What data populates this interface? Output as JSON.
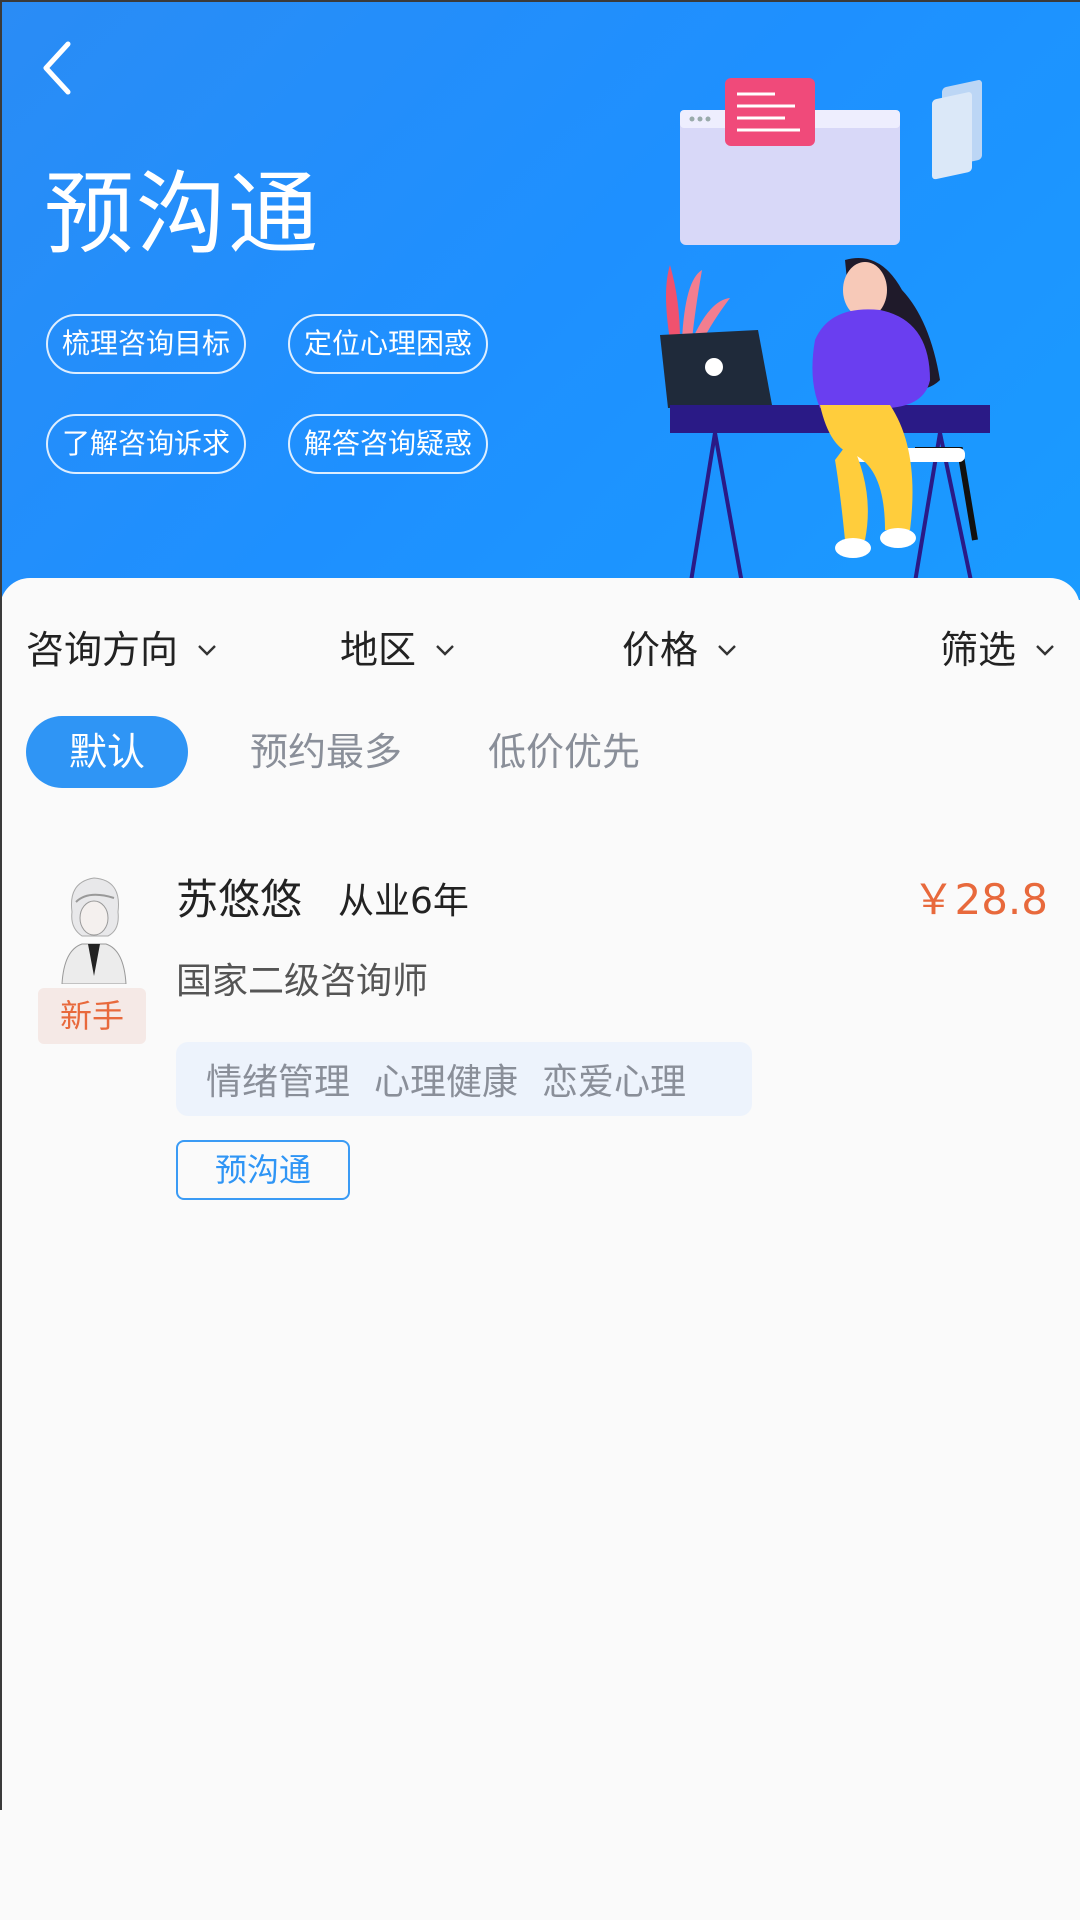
{
  "hero": {
    "title": "预沟通",
    "pills": [
      "梳理咨询目标",
      "定位心理困惑",
      "了解咨询诉求",
      "解答咨询疑惑"
    ]
  },
  "filters": [
    "咨询方向",
    "地区",
    "价格",
    "筛选"
  ],
  "sort_tabs": [
    "默认",
    "预约最多",
    "低价优先"
  ],
  "counselor": {
    "name": "苏悠悠",
    "years": "从业6年",
    "price": "￥28.8",
    "badge": "新手",
    "title": "国家二级咨询师",
    "tags": [
      "情绪管理",
      "心理健康",
      "恋爱心理"
    ],
    "action": "预沟通"
  },
  "colors": {
    "accent": "#2f95f5",
    "price": "#e8693c",
    "hero_bg": "#1e90ff"
  }
}
